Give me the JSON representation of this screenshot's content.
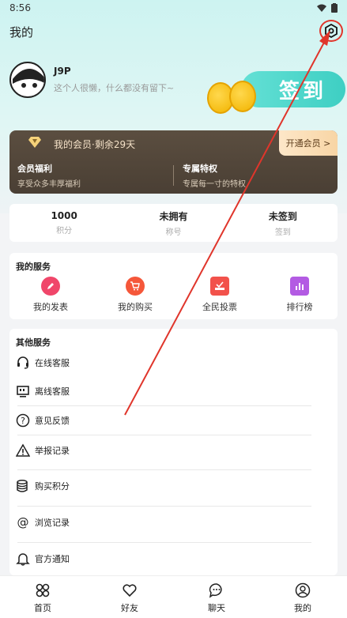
{
  "status": {
    "time": "8:56"
  },
  "header": {
    "title": "我的"
  },
  "profile": {
    "name": "J9P",
    "bio": "这个人很懒，什么都没有留下~"
  },
  "signin": {
    "label": "签到"
  },
  "vip": {
    "title": "我的会员·剩余29天",
    "open_label": "开通会员 >",
    "left_title": "会员福利",
    "left_sub": "享受众多丰厚福利",
    "right_title": "专属特权",
    "right_sub": "专属每一寸的特权"
  },
  "stats": [
    {
      "value": "1000",
      "label": "积分"
    },
    {
      "value": "未拥有",
      "label": "称号"
    },
    {
      "value": "未签到",
      "label": "签到"
    }
  ],
  "services": {
    "title": "我的服务",
    "items": [
      {
        "label": "我的发表",
        "icon": "edit-icon",
        "color": "#f0466a"
      },
      {
        "label": "我的购买",
        "icon": "cart-icon",
        "color": "#f5573a"
      },
      {
        "label": "全民投票",
        "icon": "vote-icon",
        "color": "#f2524b"
      },
      {
        "label": "排行榜",
        "icon": "chart-icon",
        "color": "#b35be3"
      }
    ]
  },
  "others": {
    "title": "其他服务",
    "items": [
      {
        "label": "在线客服",
        "icon": "headset-icon"
      },
      {
        "label": "离线客服",
        "icon": "monitor-icon"
      },
      {
        "label": "意见反馈",
        "icon": "question-icon"
      },
      {
        "label": "举报记录",
        "icon": "warning-icon"
      },
      {
        "label": "购买积分",
        "icon": "coins-icon"
      },
      {
        "label": "浏览记录",
        "icon": "at-icon"
      },
      {
        "label": "官方通知",
        "icon": "bell-icon"
      }
    ]
  },
  "tabs": [
    {
      "label": "首页",
      "icon": "home-icon"
    },
    {
      "label": "好友",
      "icon": "heart-icon"
    },
    {
      "label": "聊天",
      "icon": "chat-icon"
    },
    {
      "label": "我的",
      "icon": "user-icon"
    }
  ],
  "colors": {
    "accent": "#3ecfc3",
    "annotation": "#e0352b",
    "vip_bg": "#4a3f34"
  }
}
